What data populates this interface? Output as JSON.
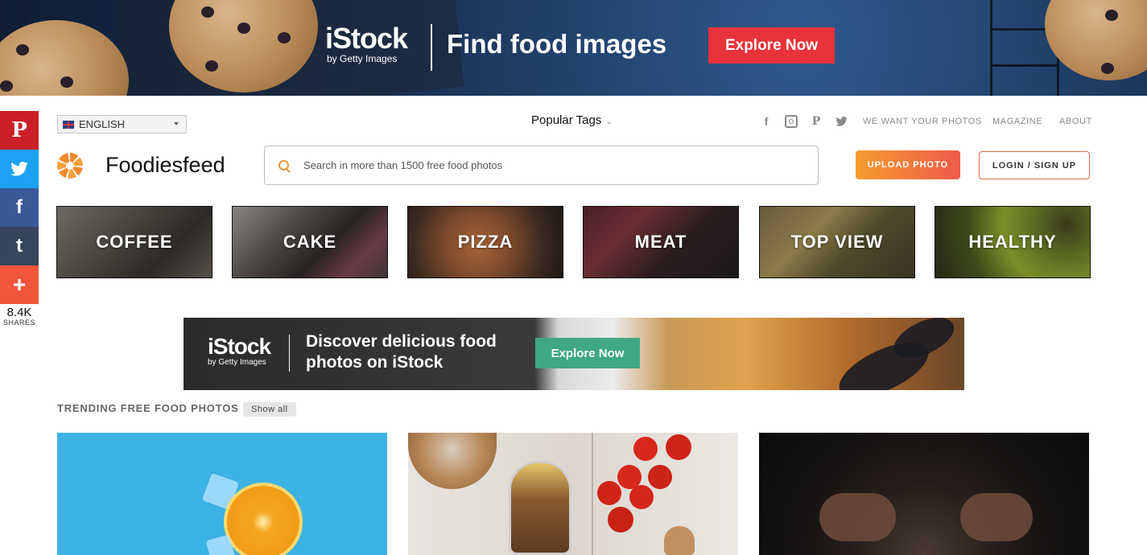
{
  "top_banner": {
    "brand": "iStock",
    "brand_sub": "by Getty Images",
    "headline": "Find food images",
    "cta": "Explore Now"
  },
  "share_bar": {
    "buttons": [
      "pinterest-icon",
      "twitter-icon",
      "facebook-icon",
      "tumblr-icon",
      "plus-icon"
    ],
    "count": "8.4K",
    "label": "SHARES",
    "colors": [
      "#cb2027",
      "#1da1f2",
      "#3b5998",
      "#35465c",
      "#f0563a"
    ]
  },
  "header": {
    "language": "ENGLISH",
    "popular_tags": "Popular Tags",
    "social": [
      "facebook-icon",
      "instagram-icon",
      "pinterest-icon",
      "twitter-icon"
    ],
    "nav": [
      "WE WANT YOUR PHOTOS",
      "MAGAZINE",
      "ABOUT"
    ],
    "brand_name": "Foodiesfeed",
    "search_placeholder": "Search in more than 1500 free food photos",
    "upload_label": "UPLOAD PHOTO",
    "login_label": "LOGIN / SIGN UP"
  },
  "categories": [
    "COFFEE",
    "CAKE",
    "PIZZA",
    "MEAT",
    "TOP VIEW",
    "HEALTHY"
  ],
  "mid_banner": {
    "brand": "iStock",
    "brand_sub": "by Getty Images",
    "headline": "Discover delicious food photos on iStock",
    "cta": "Explore Now"
  },
  "trending": {
    "title": "TRENDING FREE FOOD PHOTOS",
    "show_all": "Show all"
  }
}
